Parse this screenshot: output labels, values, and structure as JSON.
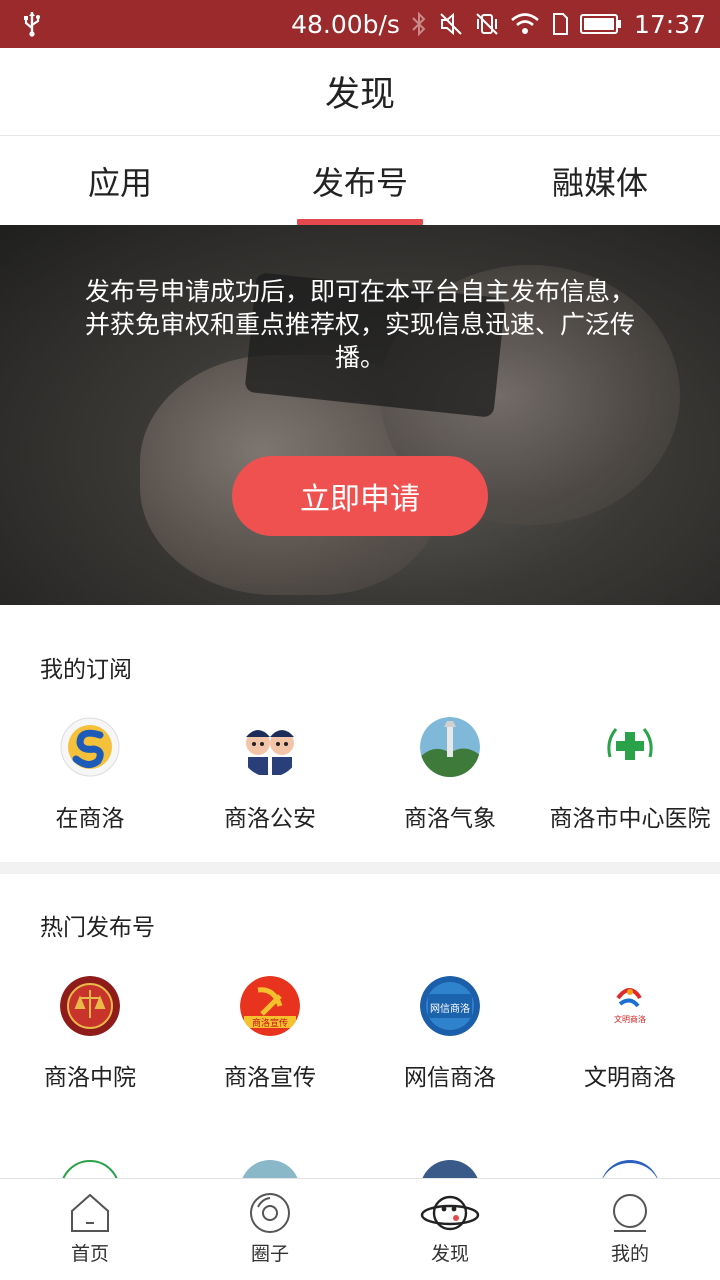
{
  "status_bar": {
    "network_speed": "48.00b/s",
    "time": "17:37",
    "icons": [
      "usb-icon",
      "bluetooth-icon",
      "mute-icon",
      "vibrate-off-icon",
      "wifi-icon",
      "sim-icon",
      "battery-icon"
    ]
  },
  "header": {
    "title": "发现"
  },
  "tabs": [
    {
      "label": "应用",
      "active": false
    },
    {
      "label": "发布号",
      "active": true
    },
    {
      "label": "融媒体",
      "active": false
    }
  ],
  "banner": {
    "text_line1": "发布号申请成功后，即可在本平台自主发布信息，",
    "text_line2": "并获免审权和重点推荐权，实现信息迅速、广泛传",
    "text_line3": "播。",
    "apply_label": "立即申请"
  },
  "subscriptions": {
    "title": "我的订阅",
    "items": [
      {
        "name": "在商洛",
        "icon": "zaishangluo-logo"
      },
      {
        "name": "商洛公安",
        "icon": "police-logo"
      },
      {
        "name": "商洛气象",
        "icon": "weather-logo"
      },
      {
        "name": "商洛市中心医院",
        "icon": "hospital-logo"
      }
    ]
  },
  "hot": {
    "title": "热门发布号",
    "items": [
      {
        "name": "商洛中院",
        "icon": "court-logo"
      },
      {
        "name": "商洛宣传",
        "icon": "publicity-logo",
        "logo_text": "商洛宣传"
      },
      {
        "name": "网信商洛",
        "icon": "wangxin-logo",
        "logo_text": "网信商洛"
      },
      {
        "name": "文明商洛",
        "icon": "wenming-logo",
        "logo_text": "文明商洛"
      }
    ]
  },
  "bottom_nav": [
    {
      "label": "首页",
      "icon": "home-icon"
    },
    {
      "label": "圈子",
      "icon": "circle-icon"
    },
    {
      "label": "发现",
      "icon": "planet-icon",
      "active": true
    },
    {
      "label": "我的",
      "icon": "profile-icon"
    }
  ],
  "colors": {
    "status_bar": "#9b2a2c",
    "accent": "#e5484d",
    "button": "#ef5150"
  }
}
